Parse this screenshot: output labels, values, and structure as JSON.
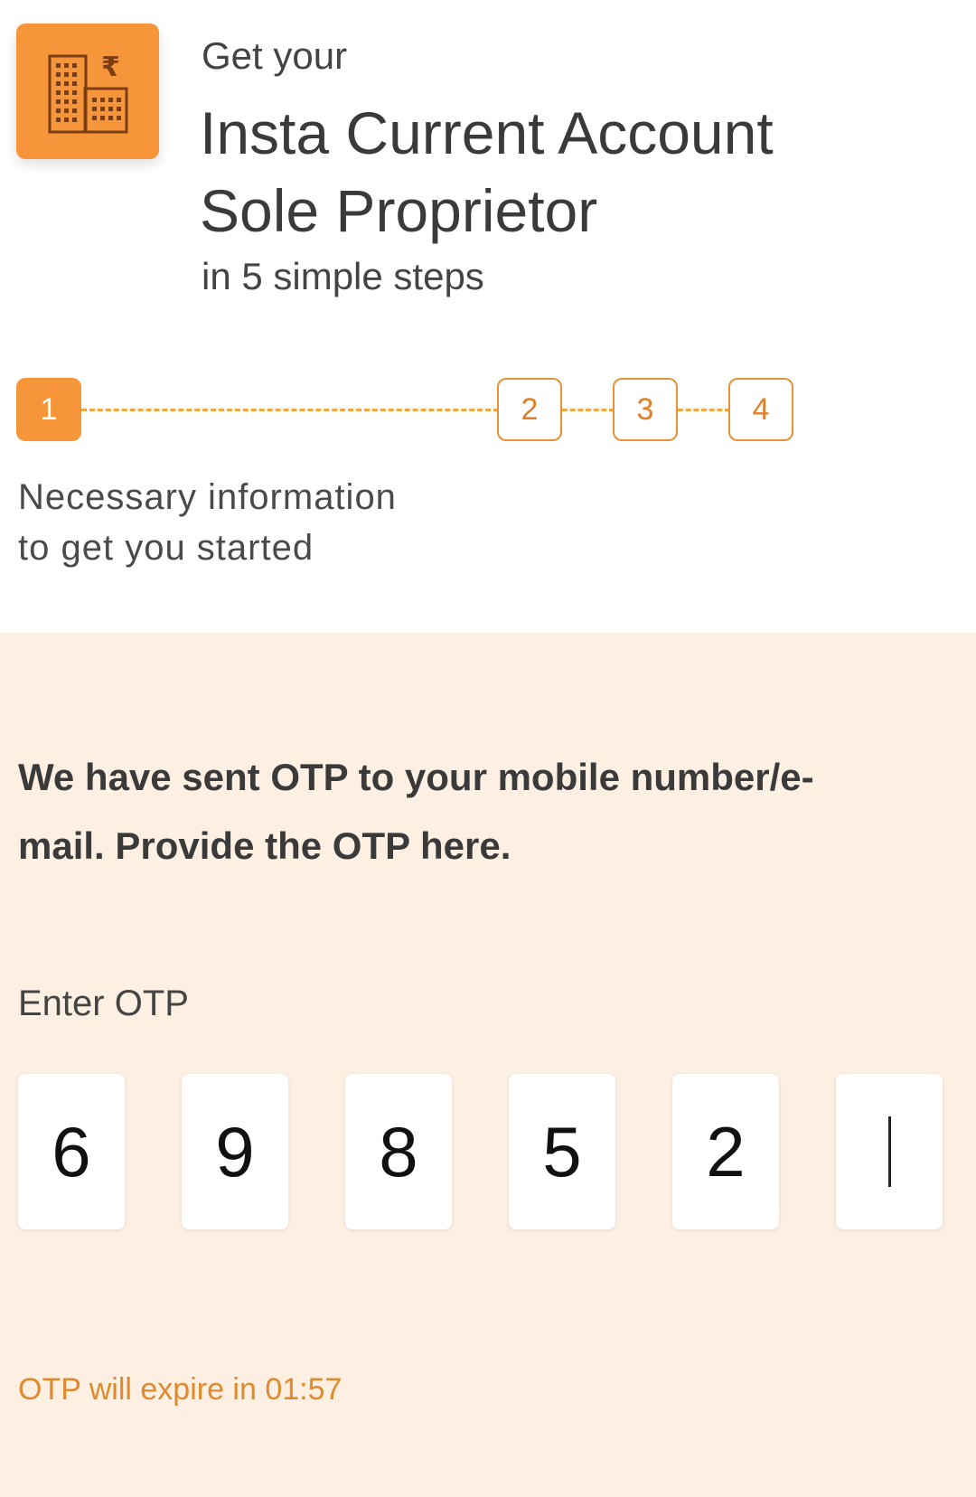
{
  "header": {
    "logo_icon": "building-rupee-icon",
    "eyebrow": "Get your",
    "title_lines": [
      "Insta Current Account",
      "Sole Proprietor"
    ],
    "subtitle": "in 5 simple steps"
  },
  "stepper": {
    "steps": [
      {
        "label": "1",
        "state": "active"
      },
      {
        "label": "2",
        "state": "pending"
      },
      {
        "label": "3",
        "state": "pending"
      },
      {
        "label": "4",
        "state": "pending"
      }
    ],
    "description_lines": [
      "Necessary information",
      "to get you started"
    ]
  },
  "otp": {
    "message_lines": [
      "We have sent OTP to your mobile number/e-",
      "mail. Provide the OTP here."
    ],
    "label": "Enter OTP",
    "digits": [
      "6",
      "9",
      "8",
      "5",
      "2",
      ""
    ],
    "expiry_text": "OTP will expire in 01:57"
  },
  "colors": {
    "accent": "#f6953a",
    "panel_bg": "#fdf0e2",
    "expiry_text": "#e08a2e"
  }
}
